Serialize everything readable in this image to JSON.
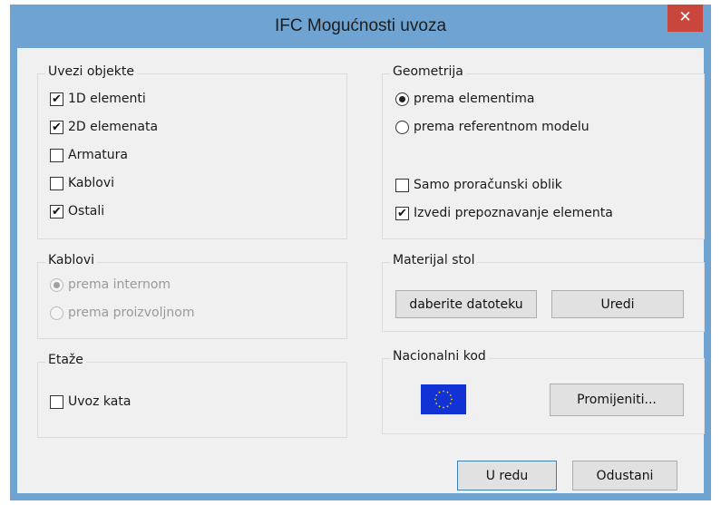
{
  "window": {
    "title": "IFC Mogućnosti uvoza",
    "close_glyph": "✕"
  },
  "uvezi_objekte": {
    "title": "Uvezi objekte",
    "items": [
      {
        "label": "1D elementi",
        "checked": true
      },
      {
        "label": "2D elemenata",
        "checked": true
      },
      {
        "label": "Armatura",
        "checked": false
      },
      {
        "label": "Kablovi",
        "checked": false
      },
      {
        "label": "Ostali",
        "checked": true
      }
    ]
  },
  "geometrija": {
    "title": "Geometrija",
    "radios": [
      {
        "label": "prema elementima",
        "selected": true
      },
      {
        "label": "prema referentnom modelu",
        "selected": false
      }
    ],
    "checks": [
      {
        "label": "Samo proračunski oblik",
        "checked": false
      },
      {
        "label": "Izvedi prepoznavanje elementa",
        "checked": true
      }
    ]
  },
  "kablovi": {
    "title": "Kablovi",
    "radios": [
      {
        "label": "prema internom",
        "selected": true,
        "disabled": true
      },
      {
        "label": "prema proizvoljnom",
        "selected": false,
        "disabled": true
      }
    ]
  },
  "materijal": {
    "title": "Materijal stol",
    "select_file_label": "daberite datoteku",
    "edit_label": "Uredi"
  },
  "etaze": {
    "title": "Etaže",
    "import_label": "Uvoz kata",
    "import_checked": false
  },
  "nacionalni_kod": {
    "title": "Nacionalni kod",
    "flag_icon": "eu-flag-icon",
    "change_label": "Promijeniti..."
  },
  "footer": {
    "ok_label": "U redu",
    "cancel_label": "Odustani"
  },
  "colors": {
    "frame": "#6fa3d2",
    "close": "#c9463d",
    "face": "#f0f0f0",
    "flag_blue": "#1232d6",
    "flag_star": "#f5d800"
  }
}
